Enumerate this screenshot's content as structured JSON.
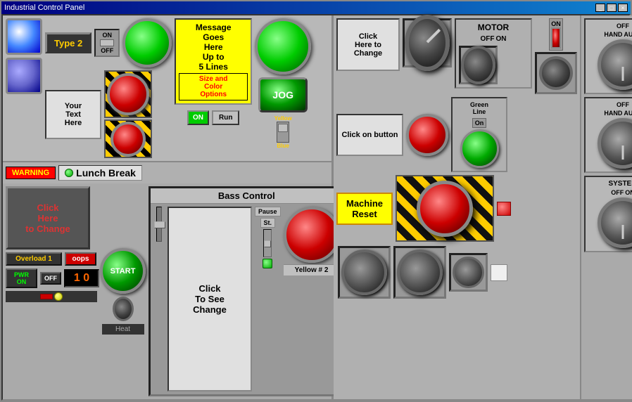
{
  "window": {
    "title": "Industrial Control Panel"
  },
  "titleBar": {
    "buttons": [
      "_",
      "□",
      "×"
    ]
  },
  "leftTop": {
    "type2Label": "Type 2",
    "onLabel": "ON",
    "offLabel": "OFF",
    "textBox": "Your\nText\nHere",
    "messageBox": "Message\nGoes\nHere\nUp to\n5 Lines",
    "sizeColorLabel": "Size and\nColor\nOptions",
    "jogLabel": "JOG",
    "warningLabel": "WARNING",
    "lunchBreakLabel": "Lunch Break",
    "onBtnLabel": "ON",
    "runBtnLabel": "Run",
    "yellowLabel": "Yellow",
    "blueLabel": "Blue"
  },
  "leftBottom": {
    "clickHereLabel": "Click\nHere\nto Change",
    "startLabel": "START",
    "overloadLabel": "Overload 1",
    "oopsLabel": "oops",
    "pwrLabel": "PWR\nON",
    "offLabel": "OFF",
    "counterValue": "1  0",
    "heatLabel": "Heat",
    "bassControlLabel": "Bass Control",
    "clickToSeeLabel": "Click\nTo See\nChange",
    "pauseLabel": "Pause",
    "stepLabel": "St.",
    "yellow2Label": "Yellow # 2"
  },
  "rightPanel": {
    "clickHereLabel": "Click\nHere to\nChange",
    "motorLabel": "MOTOR",
    "motorOffLabel": "OFF",
    "motorOnLabel": "ON",
    "onLabel": "ON",
    "clickOnBtnLabel": "Click on button",
    "greenLineLabel": "Green\nLine",
    "machineResetLabel": "Machine\nReset",
    "systemLabel": "SYSTEM",
    "systemOffLabel": "OFF",
    "systemOnLabel": "ON"
  },
  "rightKnobs": {
    "row1": {
      "offLabel": "OFF",
      "handLabel": "HAND",
      "autoLabel": "AUTO"
    },
    "row2": {
      "offLabel": "OFF",
      "handLabel": "HAND",
      "autoLabel": "AUTO"
    },
    "row3": {
      "sysLabel": "SYSTEM",
      "offLabel": "OFF",
      "onLabel": "ON"
    }
  }
}
